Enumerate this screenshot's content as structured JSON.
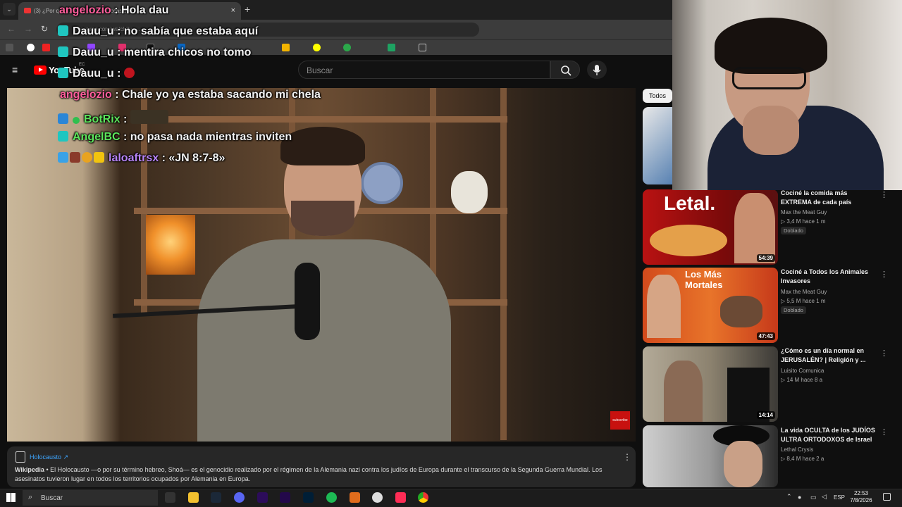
{
  "browser": {
    "tab_title": "(3) ¿Por qué ... ur of Silence Occasiona",
    "new_tab": "+",
    "url": "youtube.com/watch?v=... "
  },
  "youtube": {
    "logo_text": "YouTube",
    "country": "EC",
    "search_placeholder": "Buscar"
  },
  "chat": [
    {
      "user": "angelozio",
      "color": "#ff5e9c",
      "message": " : Hola dau"
    },
    {
      "user": "Dauu_u",
      "color": "#f5f5f5",
      "message": " : no sabía que estaba aquí"
    },
    {
      "user": "Dauu_u",
      "color": "#f5f5f5",
      "message": " : mentira chicos no tomo"
    },
    {
      "user": "Dauu_u",
      "color": "#f5f5f5",
      "message": " : "
    },
    {
      "user": "angelozio",
      "color": "#ff5e9c",
      "message": " : Chale yo ya estaba sacando mi chela"
    },
    {
      "user": "BotRix",
      "color": "#5ce65c",
      "message": " : "
    },
    {
      "user": "AngelBC",
      "color": "#5ce65c",
      "message": " : no pasa nada mientras inviten"
    },
    {
      "user": "laloaftrsx",
      "color": "#b784f7",
      "message": " : «JN 8:7-8»"
    }
  ],
  "video": {
    "subscribe_badge": "subscribe"
  },
  "info_panel": {
    "title": "Holocausto ↗",
    "source": "Wikipedia",
    "text": " • El Holocausto —o por su término hebreo, Shoá— es el genocidio realizado por el régimen de la Alemania nazi contra los judíos de Europa durante el transcurso de la Segunda Guerra Mundial. Los asesinatos tuvieron lugar en todos los territorios ocupados por Alemania en Europa."
  },
  "sidebar": {
    "chip": "Todos",
    "videos": [
      {
        "title": "Cociné la comida más EXTREMA de cada país",
        "channel": "Max the Meat Guy",
        "meta": "▷ 3,4 M  hace 1 m",
        "badge": "Doblado",
        "duration": "54:39",
        "thumb_text": "Letal."
      },
      {
        "title": "Cociné a Todos los Animales Invasores",
        "channel": "Max the Meat Guy",
        "meta": "▷ 5,5 M  hace 1 m",
        "badge": "Doblado",
        "duration": "47:43",
        "thumb_text": "Los Más Mortales"
      },
      {
        "title": "¿Cómo es un día normal en JERUSALÉN? | Religión y ...",
        "channel": "Luisito Comunica",
        "meta": "▷ 14 M  hace 8 a",
        "badge": "",
        "duration": "14:14",
        "thumb_text": ""
      },
      {
        "title": "La vida OCULTA de los JUDÍOS ULTRA ORTODOXOS de Israel",
        "channel": "Lethal Crysis",
        "meta": "▷ 8,4 M  hace 2 a",
        "badge": "",
        "duration": "",
        "thumb_text": ""
      }
    ]
  },
  "taskbar": {
    "search": "Buscar",
    "lang": "ESP",
    "time": "22:53",
    "date": "7/8/2026"
  },
  "colors": {
    "yt_red": "#ff0000",
    "link": "#3ea6ff"
  }
}
